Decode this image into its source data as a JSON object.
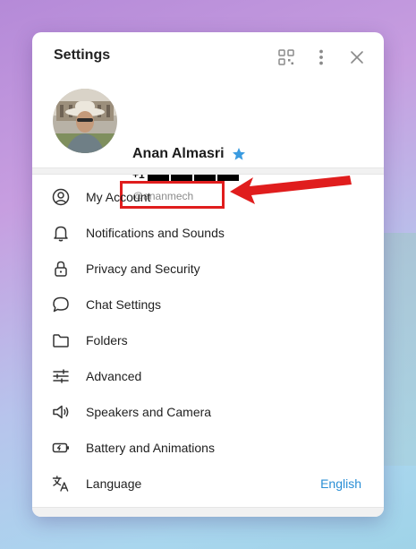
{
  "window": {
    "title": "Settings"
  },
  "header_icons": {
    "qr": "qr-code-icon",
    "more": "more-vertical-icon",
    "close": "close-icon"
  },
  "profile": {
    "name": "Anan Almasri",
    "premium_badge": "star-icon",
    "phone_prefix": "+1",
    "username": "@ananmech"
  },
  "menu": {
    "items": [
      {
        "label": "My Account",
        "icon": "account-icon"
      },
      {
        "label": "Notifications and Sounds",
        "icon": "bell-icon"
      },
      {
        "label": "Privacy and Security",
        "icon": "lock-icon"
      },
      {
        "label": "Chat Settings",
        "icon": "chat-bubble-icon"
      },
      {
        "label": "Folders",
        "icon": "folder-icon"
      },
      {
        "label": "Advanced",
        "icon": "sliders-icon"
      },
      {
        "label": "Speakers and Camera",
        "icon": "speaker-icon"
      },
      {
        "label": "Battery and Animations",
        "icon": "battery-icon"
      },
      {
        "label": "Language",
        "icon": "translate-icon",
        "value": "English"
      }
    ]
  },
  "colors": {
    "accent": "#2a8fd6",
    "annotation": "#e01d1d",
    "star": "#3a9be0"
  }
}
